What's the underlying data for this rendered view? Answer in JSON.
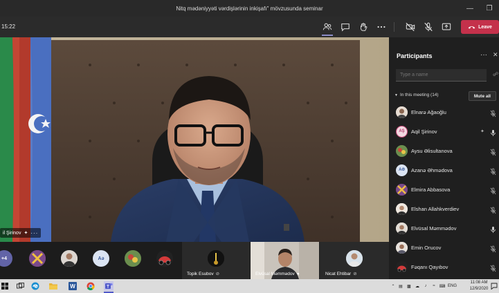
{
  "window": {
    "title": "Nitq mədəniyyəti vərdişlərinin inkişafı\" mövzusunda seminar"
  },
  "meeting": {
    "timer": "15:22",
    "leave_label": "Leave"
  },
  "main_video": {
    "speaker_label": "il Şirinov"
  },
  "participants": {
    "title": "Participants",
    "search_placeholder": "Type a name",
    "section_label": "In this meeting (14)",
    "mute_all_label": "Mute all",
    "items": [
      {
        "name": "Elnarə Ağaoğlu",
        "avatar": "photo",
        "mic": "muted"
      },
      {
        "name": "Aqil Şirinov",
        "avatar": "AŞ",
        "mic": "active"
      },
      {
        "name": "Aysu Əlisultanova",
        "avatar": "photo",
        "mic": "muted"
      },
      {
        "name": "Azanə Əhmədova",
        "avatar": "AƏ",
        "mic": "muted"
      },
      {
        "name": "Elmira Abbasova",
        "avatar": "photo",
        "mic": "muted"
      },
      {
        "name": "Elshan Allahkverdiev",
        "avatar": "photo",
        "mic": "muted"
      },
      {
        "name": "Elvüsal Məmmədov",
        "avatar": "photo",
        "mic": "on"
      },
      {
        "name": "Emin Orucov",
        "avatar": "photo",
        "mic": "muted"
      },
      {
        "name": "Fəqanı Qayıbov",
        "avatar": "photo",
        "mic": "muted"
      }
    ]
  },
  "strip": {
    "overflow_count": "+4",
    "thumb_initials": "Aə",
    "tiles": [
      {
        "name": "Topik Esubov"
      },
      {
        "name": "Elvüsal Məmmədov"
      },
      {
        "name": "Nicat Ehtibar"
      }
    ]
  },
  "taskbar": {
    "language": "ENG",
    "time": "11:08 AM",
    "date": "12/9/2020"
  },
  "colors": {
    "leave": "#c4314b",
    "panel_bg": "#1f1f1f",
    "accent": "#6264a7"
  }
}
